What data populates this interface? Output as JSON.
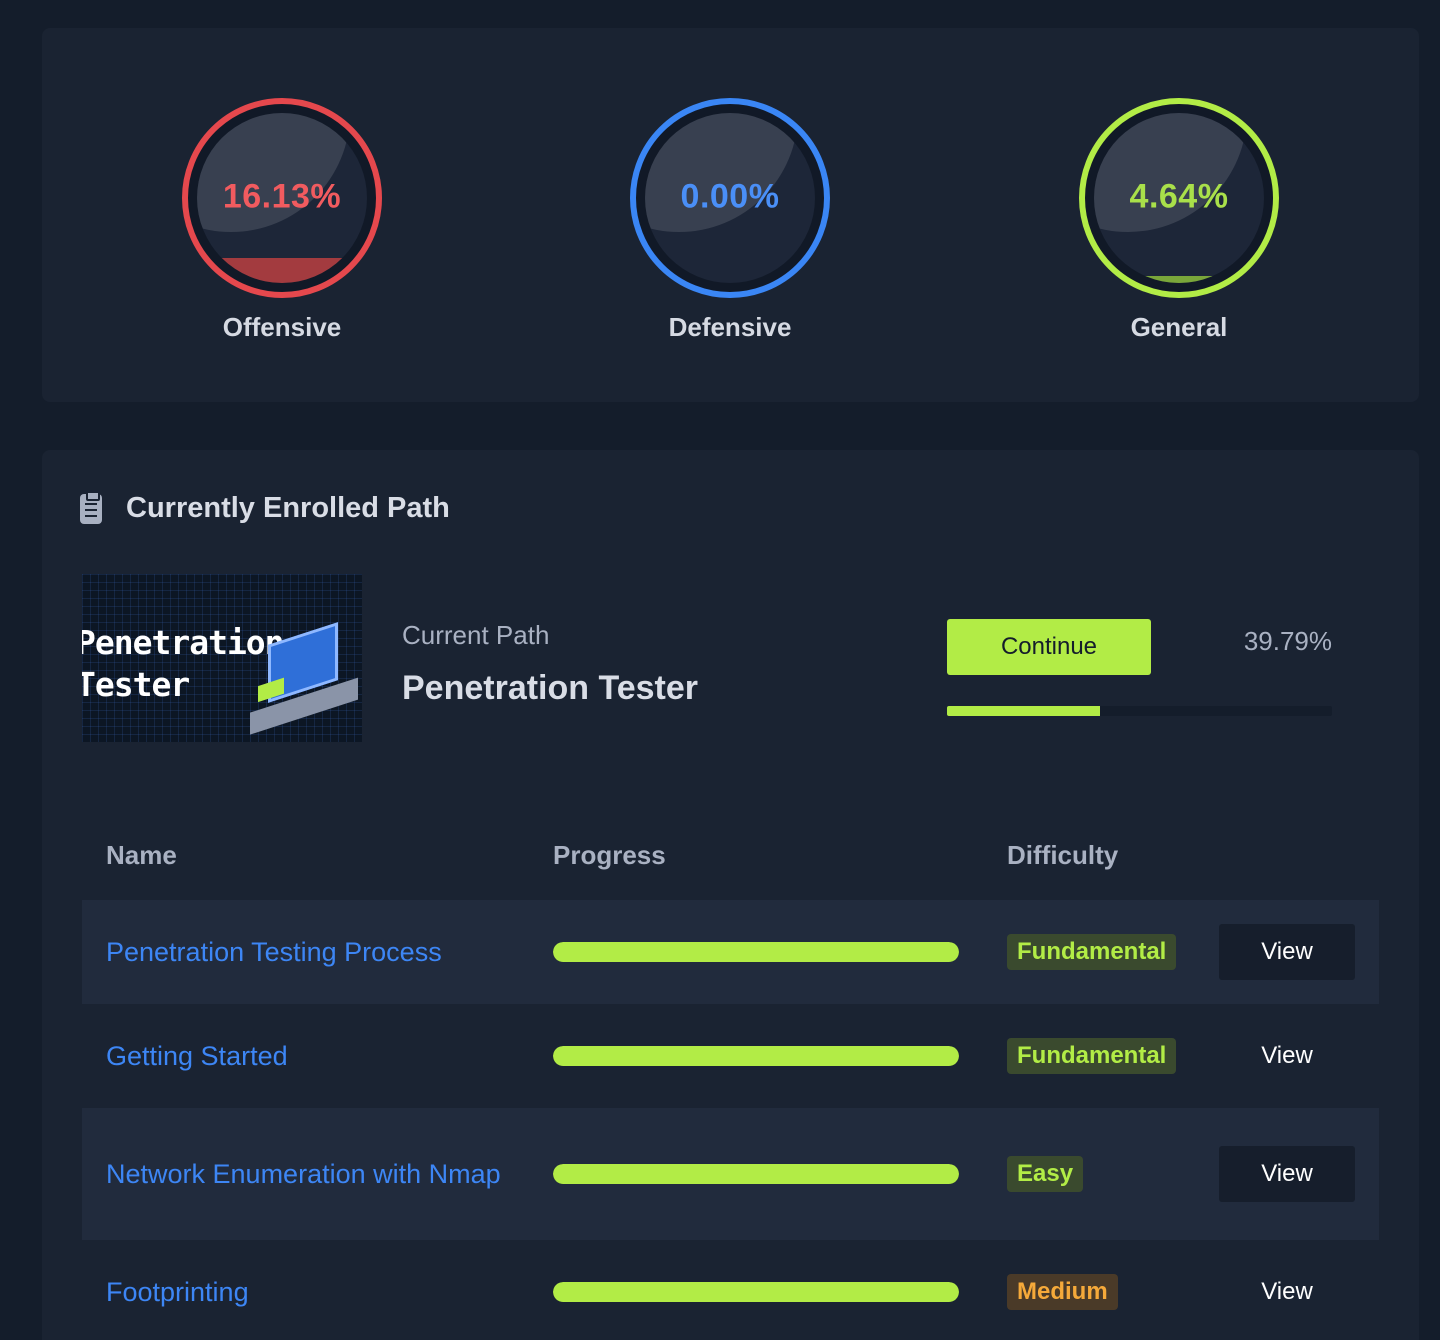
{
  "stats": [
    {
      "key": "offensive",
      "value": "16.13%",
      "label": "Offensive",
      "fraction": 0.1613,
      "color": "#e5484d"
    },
    {
      "key": "defensive",
      "value": "0.00%",
      "label": "Defensive",
      "fraction": 0.0,
      "color": "#3a86f5"
    },
    {
      "key": "general",
      "value": "4.64%",
      "label": "General",
      "fraction": 0.0464,
      "color": "#b2ec46"
    }
  ],
  "enrolled": {
    "section_title": "Currently Enrolled Path",
    "section_icon": "clipboard-icon",
    "thumbnail_text_line1": "Penetration",
    "thumbnail_text_line2": "Tester",
    "current_path_label": "Current Path",
    "path_name": "Penetration Tester",
    "continue_label": "Continue",
    "progress_text": "39.79%",
    "progress_fraction": 0.3979
  },
  "table": {
    "headers": {
      "name": "Name",
      "progress": "Progress",
      "difficulty": "Difficulty"
    },
    "rows": [
      {
        "name": "Penetration Testing Process",
        "progress": 1.0,
        "difficulty": "Fundamental",
        "difficulty_class": "fundamental",
        "action": "View"
      },
      {
        "name": "Getting Started",
        "progress": 1.0,
        "difficulty": "Fundamental",
        "difficulty_class": "fundamental",
        "action": "View"
      },
      {
        "name": "Network Enumeration with Nmap",
        "progress": 1.0,
        "difficulty": "Easy",
        "difficulty_class": "easy",
        "action": "View"
      },
      {
        "name": "Footprinting",
        "progress": 1.0,
        "difficulty": "Medium",
        "difficulty_class": "medium",
        "action": "View"
      }
    ]
  },
  "colors": {
    "accent_green": "#b2ec46",
    "link_blue": "#3d86f5",
    "offensive_red": "#e5484d",
    "defensive_blue": "#3a86f5",
    "medium_orange": "#f5a93a"
  }
}
